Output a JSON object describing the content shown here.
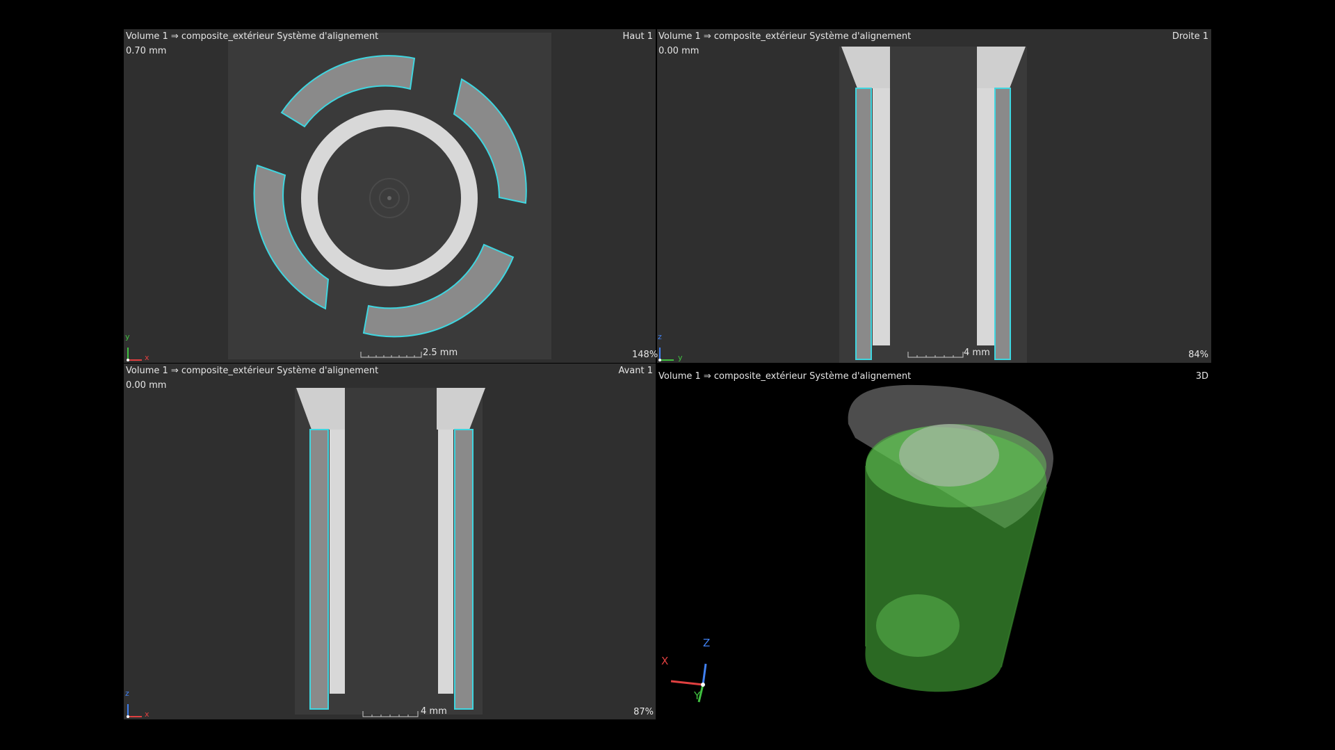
{
  "viewports": {
    "top": {
      "title": "Volume 1 ⇒ composite_extérieur Système d'alignement",
      "name": "Haut 1",
      "slice": "0.70 mm",
      "scale": "2.5 mm",
      "zoom": "148%",
      "axis_h": "x",
      "axis_v": "y"
    },
    "right": {
      "title": "Volume 1 ⇒ composite_extérieur Système d'alignement",
      "name": "Droite 1",
      "slice": "0.00 mm",
      "scale": "4 mm",
      "zoom": "84%",
      "axis_h": "y",
      "axis_v": "z"
    },
    "front": {
      "title": "Volume 1 ⇒ composite_extérieur Système d'alignement",
      "name": "Avant 1",
      "slice": "0.00 mm",
      "scale": "4 mm",
      "zoom": "87%",
      "axis_h": "x",
      "axis_v": "z"
    },
    "view3d": {
      "title": "Volume 1 ⇒ composite_extérieur Système d'alignement",
      "name": "3D",
      "axis_x": "X",
      "axis_y": "Y",
      "axis_z": "Z"
    }
  },
  "colors": {
    "outline": "#3fd6e0",
    "green": "#4fbf3f",
    "axis_x": "#e04040",
    "axis_y": "#40c040",
    "axis_z": "#4080f0"
  }
}
